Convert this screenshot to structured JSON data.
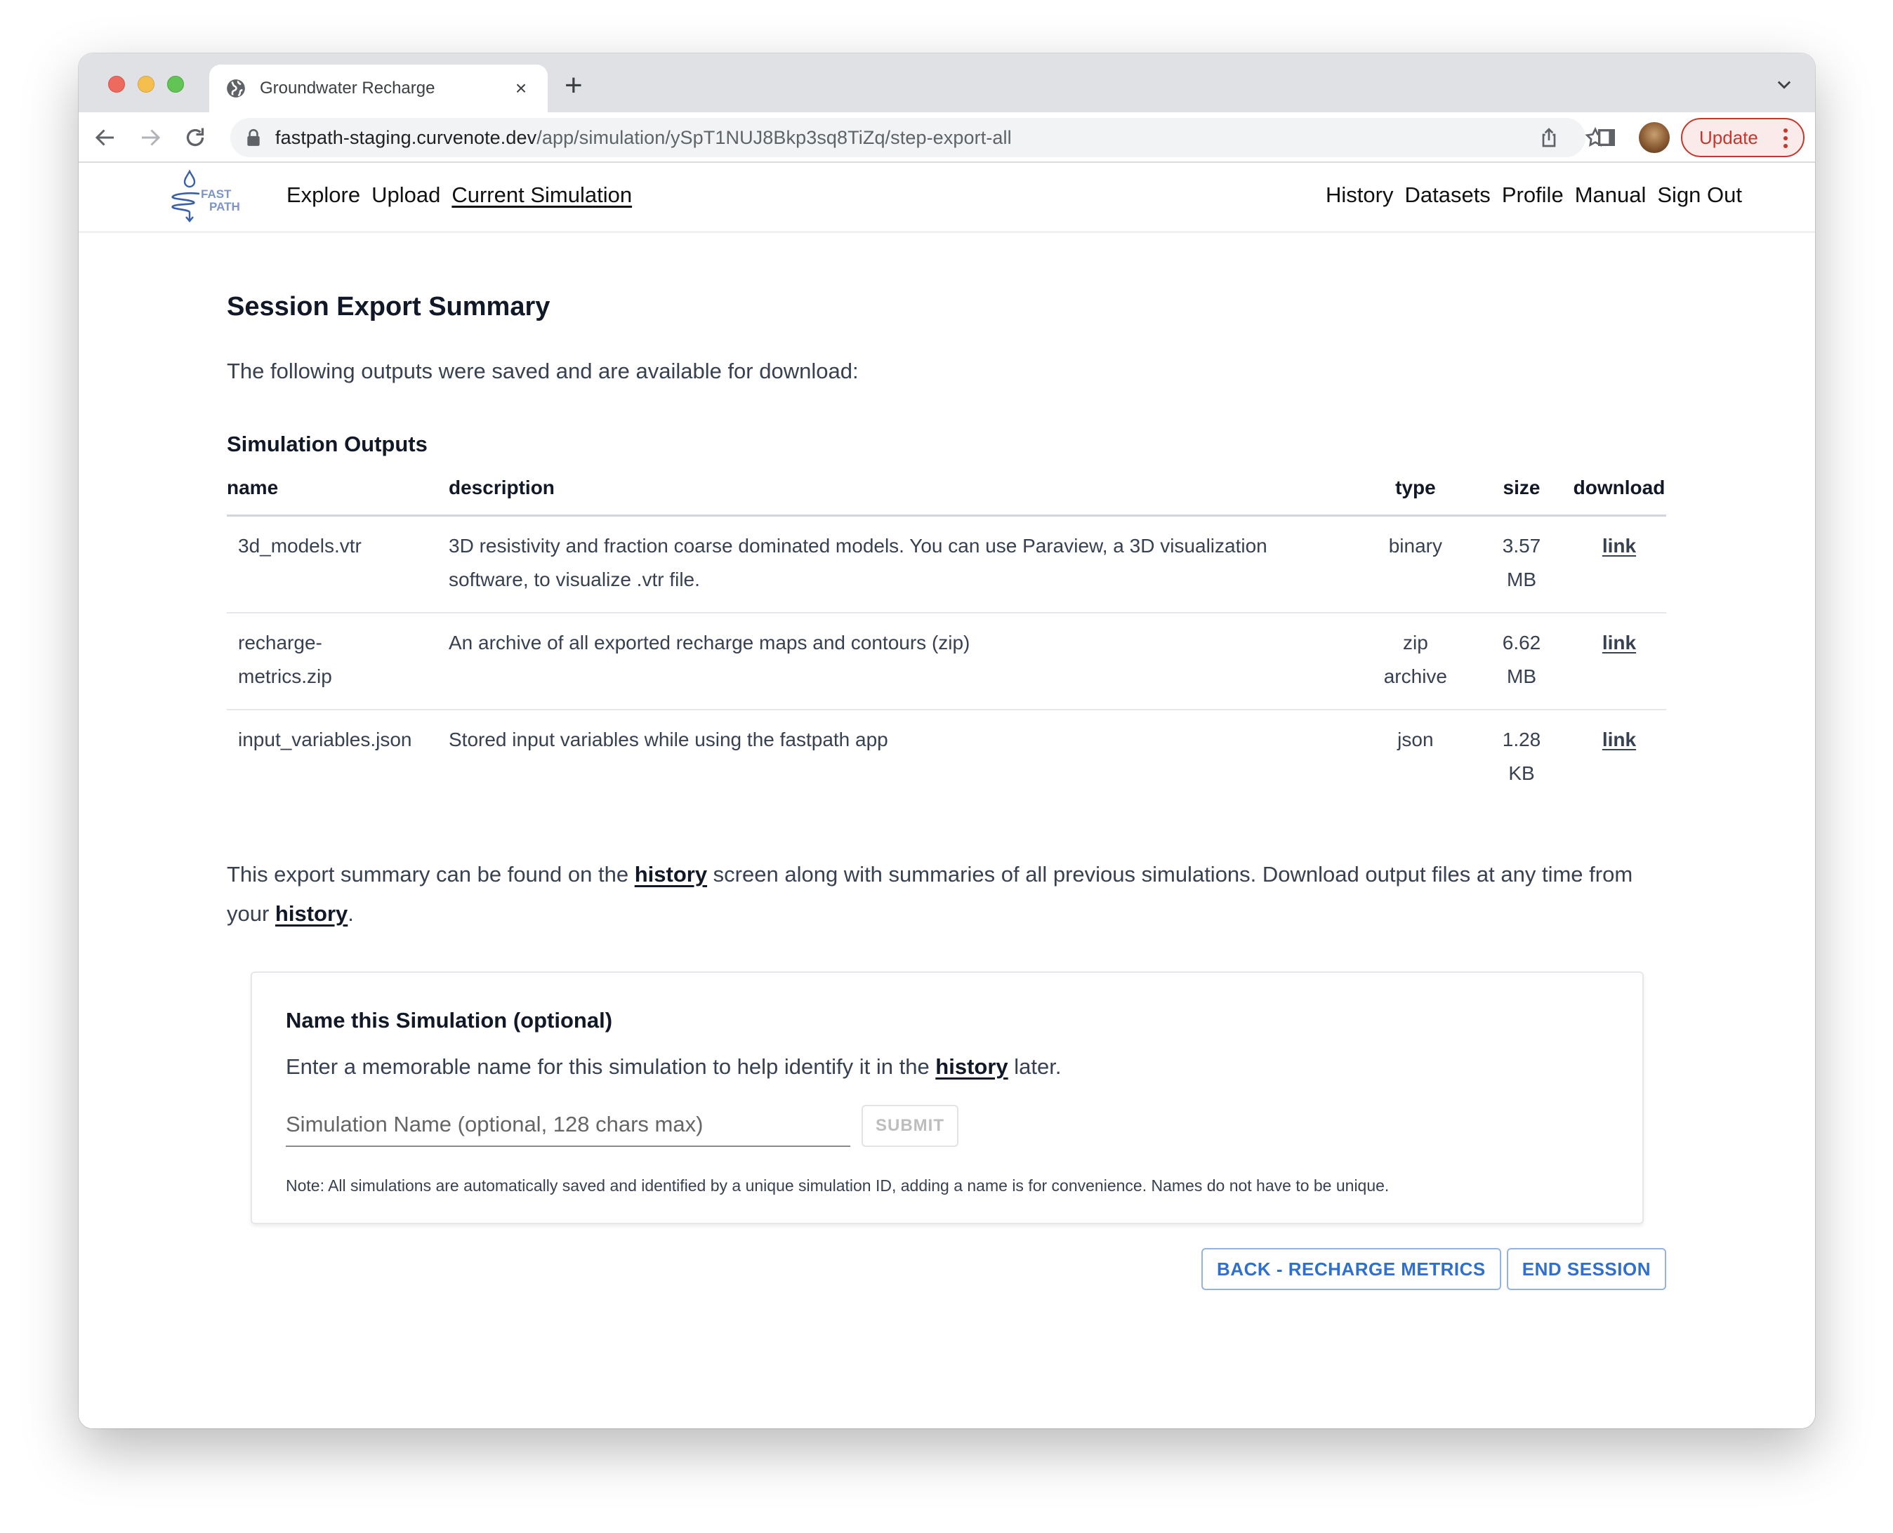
{
  "browser": {
    "tab_title": "Groundwater Recharge",
    "tab_close": "×",
    "new_tab": "+",
    "url_host": "fastpath-staging.curvenote.dev",
    "url_path": "/app/simulation/ySpT1NUJ8Bkp3sq8TiZq/step-export-all",
    "update_label": "Update"
  },
  "appbar": {
    "logo_text_1": "FAST",
    "logo_text_2": "PATH",
    "nav_left": [
      "Explore",
      "Upload",
      "Current Simulation"
    ],
    "nav_right": [
      "History",
      "Datasets",
      "Profile",
      "Manual",
      "Sign Out"
    ],
    "active": "Current Simulation"
  },
  "main": {
    "title": "Session Export Summary",
    "intro": "The following outputs were saved and are available for download:",
    "outputs_heading": "Simulation Outputs",
    "table": {
      "columns": [
        "name",
        "description",
        "type",
        "size",
        "download"
      ],
      "rows": [
        {
          "name": "3d_models.vtr",
          "description": "3D resistivity and fraction coarse dominated models. You can use Paraview, a 3D visualization software, to visualize .vtr file.",
          "type": "binary",
          "size": "3.57 MB",
          "download": "link"
        },
        {
          "name": "recharge-metrics.zip",
          "description": "An archive of all exported recharge maps and contours (zip)",
          "type": "zip archive",
          "size": "6.62 MB",
          "download": "link"
        },
        {
          "name": "input_variables.json",
          "description": "Stored input variables while using the fastpath app",
          "type": "json",
          "size": "1.28 KB",
          "download": "link"
        }
      ]
    },
    "summary": {
      "part1": "This export summary can be found on the ",
      "link1": "history",
      "part2": " screen along with summaries of all previous simulations. Download output files at any time from your ",
      "link2": "history",
      "part3": "."
    }
  },
  "name_card": {
    "title": "Name this Simulation (optional)",
    "text_before": "Enter a memorable name for this simulation to help identify it in the ",
    "text_link": "history",
    "text_after": " later.",
    "input_value": "",
    "input_placeholder": "Simulation Name (optional, 128 chars max)",
    "submit_label": "SUBMIT",
    "note": "Note: All simulations are automatically saved and identified by a unique simulation ID, adding a name is for convenience. Names do not have to be unique."
  },
  "actions": {
    "back_label": "BACK - RECHARGE METRICS",
    "end_label": "END SESSION"
  },
  "colors": {
    "accent": "#2f6fce",
    "update": "#c5372c",
    "logo": "#3a5fa8"
  }
}
